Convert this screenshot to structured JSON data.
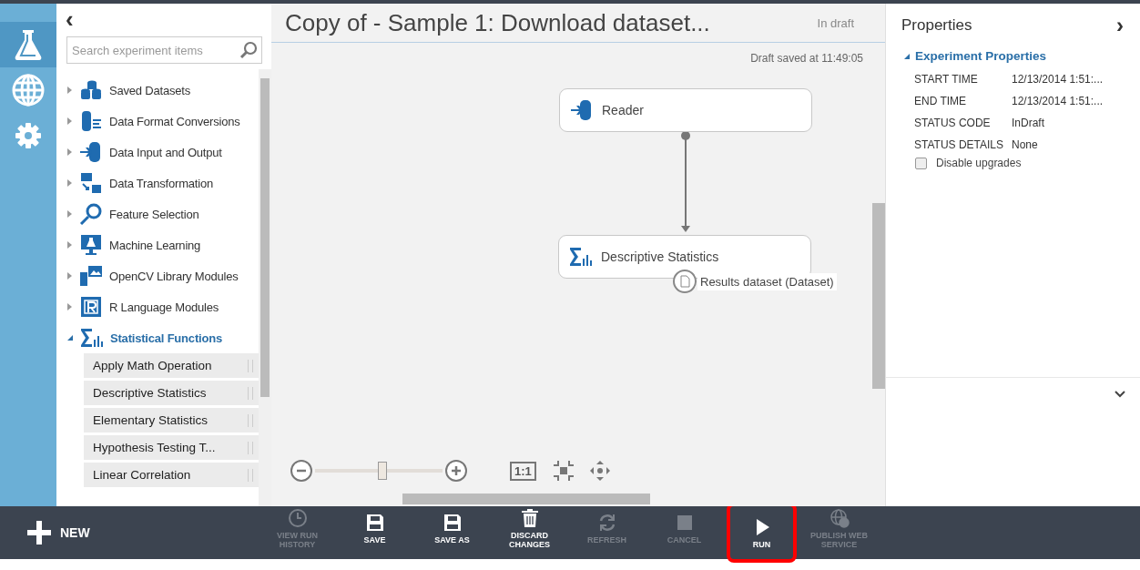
{
  "rail": {
    "items": [
      {
        "selected": true
      },
      {
        "selected": false
      },
      {
        "selected": false
      }
    ]
  },
  "palette": {
    "collapse": "‹",
    "search": {
      "placeholder": "Search experiment items"
    },
    "tree": [
      {
        "label": "Saved Datasets",
        "expanded": false
      },
      {
        "label": "Data Format Conversions",
        "expanded": false
      },
      {
        "label": "Data Input and Output",
        "expanded": false
      },
      {
        "label": "Data Transformation",
        "expanded": false
      },
      {
        "label": "Feature Selection",
        "expanded": false
      },
      {
        "label": "Machine Learning",
        "expanded": false
      },
      {
        "label": "OpenCV Library Modules",
        "expanded": false
      },
      {
        "label": "R Language Modules",
        "expanded": false
      },
      {
        "label": "Statistical Functions",
        "expanded": true,
        "children": [
          "Apply Math Operation",
          "Descriptive Statistics",
          "Elementary Statistics",
          "Hypothesis Testing T...",
          "Linear Correlation"
        ]
      }
    ]
  },
  "experiment": {
    "title": "Copy of - Sample 1: Download dataset...",
    "status": "In draft",
    "saved": "Draft saved at 11:49:05",
    "nodes": [
      {
        "label": "Reader"
      },
      {
        "label": "Descriptive Statistics",
        "port_label": "Results dataset (Dataset)"
      }
    ],
    "zoom": {
      "level": 0.53,
      "actual_size": "1:1"
    }
  },
  "properties": {
    "title": "Properties",
    "collapse": "›",
    "section": "Experiment Properties",
    "rows": [
      {
        "key": "START TIME",
        "value": "12/13/2014 1:51:..."
      },
      {
        "key": "END TIME",
        "value": "12/13/2014 1:51:..."
      },
      {
        "key": "STATUS CODE",
        "value": "InDraft"
      },
      {
        "key": "STATUS DETAILS",
        "value": "None"
      }
    ],
    "checkbox": {
      "label": "Disable upgrades",
      "checked": false
    }
  },
  "toolbar": {
    "new": "NEW",
    "buttons": [
      {
        "label": "VIEW RUN HISTORY",
        "disabled": true,
        "highlighted": false
      },
      {
        "label": "SAVE",
        "disabled": false,
        "highlighted": false
      },
      {
        "label": "SAVE AS",
        "disabled": false,
        "highlighted": false
      },
      {
        "label": "DISCARD CHANGES",
        "disabled": false,
        "highlighted": false
      },
      {
        "label": "REFRESH",
        "disabled": true,
        "highlighted": false
      },
      {
        "label": "CANCEL",
        "disabled": true,
        "highlighted": false
      },
      {
        "label": "RUN",
        "disabled": false,
        "highlighted": true
      },
      {
        "label": "PUBLISH WEB SERVICE",
        "disabled": true,
        "highlighted": false
      }
    ]
  }
}
